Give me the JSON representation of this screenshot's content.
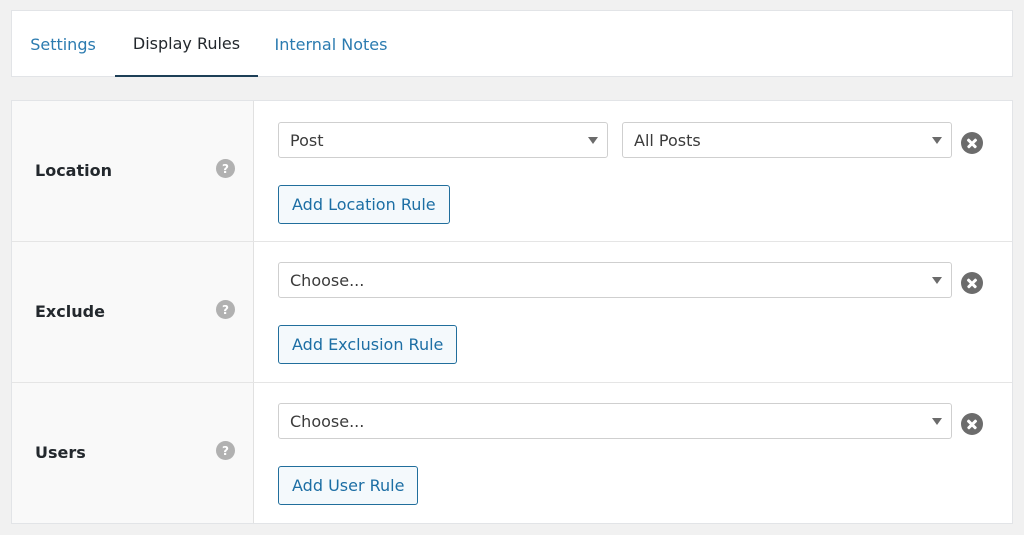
{
  "tabs": [
    {
      "label": "Settings",
      "active": false
    },
    {
      "label": "Display Rules",
      "active": true
    },
    {
      "label": "Internal Notes",
      "active": false
    }
  ],
  "rules": {
    "location": {
      "label": "Location",
      "help": "?",
      "select1_value": "Post",
      "select2_value": "All Posts",
      "add_label": "Add Location Rule"
    },
    "exclude": {
      "label": "Exclude",
      "help": "?",
      "select_value": "Choose...",
      "add_label": "Add Exclusion Rule"
    },
    "users": {
      "label": "Users",
      "help": "?",
      "select_value": "Choose...",
      "add_label": "Add User Rule"
    }
  },
  "icons": {
    "help": "question-circle-icon",
    "remove": "remove-circle-icon",
    "caret": "chevron-down-icon"
  },
  "colors": {
    "link": "#2b7bb0",
    "active_tab_underline": "#1d3f57",
    "button_border": "#216e9c",
    "button_text": "#1c6ea4"
  }
}
